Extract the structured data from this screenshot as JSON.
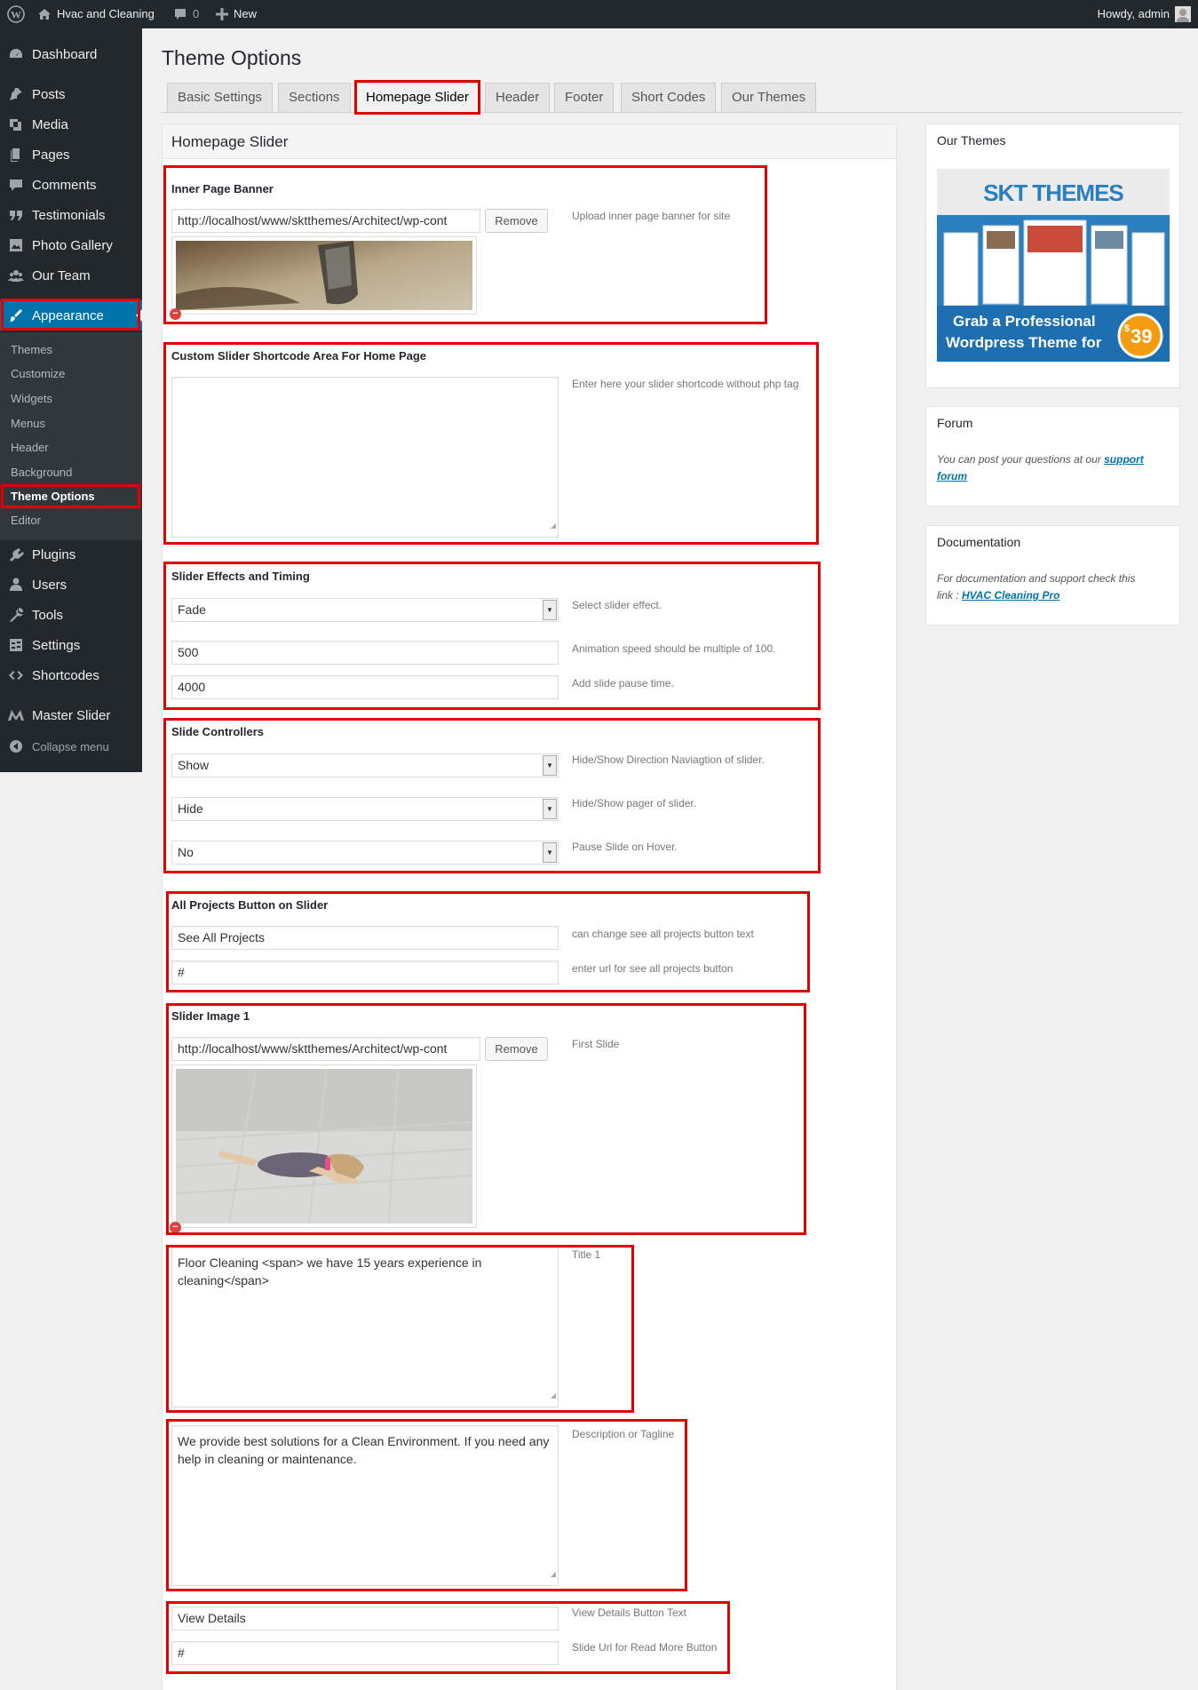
{
  "adminbar": {
    "site_name": "Hvac and Cleaning",
    "comments_count": "0",
    "new_label": "New",
    "howdy": "Howdy, admin"
  },
  "sidebar": {
    "items": [
      {
        "label": "Dashboard",
        "icon": "dashboard-icon"
      },
      {
        "label": "Posts",
        "icon": "pin-icon"
      },
      {
        "label": "Media",
        "icon": "media-icon"
      },
      {
        "label": "Pages",
        "icon": "pages-icon"
      },
      {
        "label": "Comments",
        "icon": "comment-icon"
      },
      {
        "label": "Testimonials",
        "icon": "quote-icon"
      },
      {
        "label": "Photo Gallery",
        "icon": "gallery-icon"
      },
      {
        "label": "Our Team",
        "icon": "team-icon"
      },
      {
        "label": "Appearance",
        "icon": "brush-icon"
      },
      {
        "label": "Plugins",
        "icon": "plugin-icon"
      },
      {
        "label": "Users",
        "icon": "user-icon"
      },
      {
        "label": "Tools",
        "icon": "wrench-icon"
      },
      {
        "label": "Settings",
        "icon": "settings-icon"
      },
      {
        "label": "Shortcodes",
        "icon": "code-icon"
      },
      {
        "label": "Master Slider",
        "icon": "master-slider-icon"
      },
      {
        "label": "Collapse menu",
        "icon": "collapse-icon"
      }
    ],
    "submenu": [
      "Themes",
      "Customize",
      "Widgets",
      "Menus",
      "Header",
      "Background",
      "Theme Options",
      "Editor"
    ]
  },
  "page": {
    "title": "Theme Options",
    "tabs": [
      "Basic Settings",
      "Sections",
      "Homepage Slider",
      "Header",
      "Footer",
      "Short Codes",
      "Our Themes"
    ],
    "active_tab": "Homepage Slider",
    "section_title": "Homepage Slider"
  },
  "fields": {
    "inner_banner": {
      "label": "Inner Page Banner",
      "value": "http://localhost/www/sktthemes/Architect/wp-cont",
      "button": "Remove",
      "help": "Upload inner page banner for site"
    },
    "custom_slider": {
      "label": "Custom Slider Shortcode Area For Home Page",
      "value": "",
      "help": "Enter here your slider shortcode without php tag"
    },
    "effects": {
      "label": "Slider Effects and Timing",
      "effect": "Fade",
      "effect_help": "Select slider effect.",
      "speed": "500",
      "speed_help": "Animation speed should be multiple of 100.",
      "pause": "4000",
      "pause_help": "Add slide pause time."
    },
    "controllers": {
      "label": "Slide Controllers",
      "direction": "Show",
      "direction_help": "Hide/Show Direction Naviagtion of slider.",
      "pager": "Hide",
      "pager_help": "Hide/Show pager of slider.",
      "hover": "No",
      "hover_help": "Pause Slide on Hover."
    },
    "projects": {
      "label": "All Projects Button on Slider",
      "text": "See All Projects",
      "text_help": "can change see all projects button text",
      "url": "#",
      "url_help": "enter url for see all projects button"
    },
    "slide1": {
      "label": "Slider Image 1",
      "value": "http://localhost/www/sktthemes/Architect/wp-cont",
      "button": "Remove",
      "help": "First Slide",
      "title": "Floor Cleaning <span> we have 15 years experience in cleaning</span>",
      "title_help": "Title 1",
      "desc": "We provide best solutions for a Clean Environment. If you need any help in cleaning or maintenance.",
      "desc_help": "Description or Tagline",
      "btn_text": "View Details",
      "btn_text_help": "View Details Button Text",
      "btn_url": "#",
      "btn_url_help": "Slide Url for Read More Button"
    }
  },
  "widgets": {
    "our_themes": {
      "title": "Our Themes",
      "brand": "SKT THEMES",
      "promo_line1": "Grab a Professional",
      "promo_line2": "Wordpress Theme for",
      "price_symbol": "$",
      "price": "39"
    },
    "forum": {
      "title": "Forum",
      "text": "You can post your questions at our ",
      "link1": "support",
      "link2": "forum"
    },
    "docs": {
      "title": "Documentation",
      "text1": "For documentation and support check this",
      "text2": "link : ",
      "link": "HVAC Cleaning Pro"
    }
  }
}
